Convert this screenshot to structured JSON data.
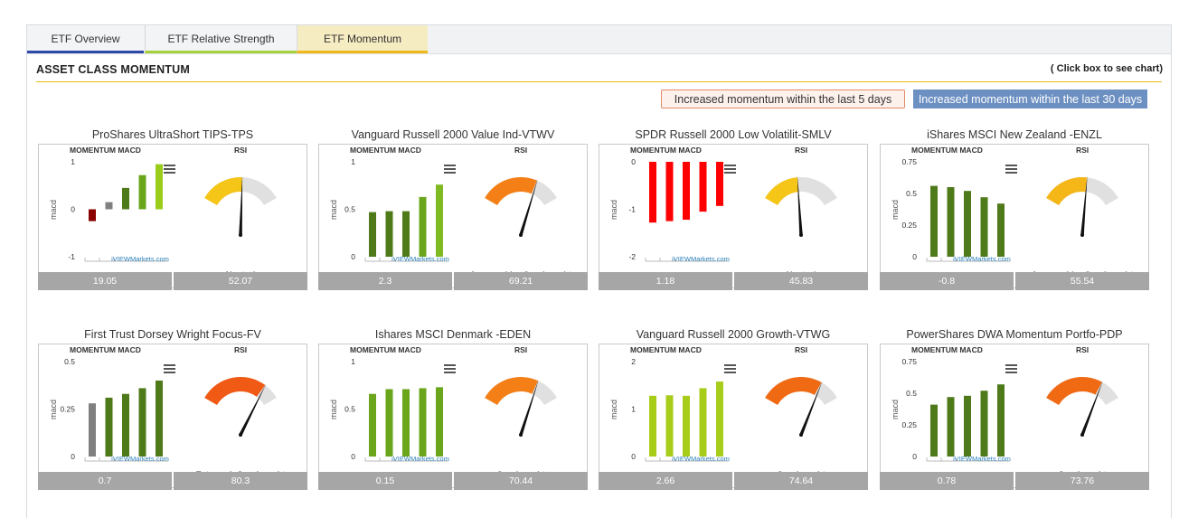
{
  "tabs": [
    {
      "label": "ETF Overview"
    },
    {
      "label": "ETF Relative Strength"
    },
    {
      "label": "ETF Momentum"
    }
  ],
  "header": {
    "title": "ASSET CLASS MOMENTUM",
    "hint": "( Click box to see chart)"
  },
  "legend": {
    "five_day": "Increased momentum within the last 5 days",
    "thirty_day": "Increased momentum within the last 30 days",
    "five_day_color": "#e38a6a",
    "thirty_day_color": "#6d90c2"
  },
  "labels": {
    "macd": "MOMENTUM MACD",
    "rsi": "RSI",
    "axis": "macd",
    "watermark": "iVIEWMarkets.com",
    "menu_icon": "hamburger-menu-icon"
  },
  "chart_data": [
    {
      "type": "bar",
      "title": "ProShares UltraShort TIPS-TPS",
      "ylim": [
        -1,
        1
      ],
      "yticks": [
        1,
        0,
        -1
      ],
      "values": [
        -0.25,
        0.15,
        0.45,
        0.72,
        0.95
      ],
      "colors": [
        "#8b0000",
        "#808080",
        "#4f7a1a",
        "#6aa51c",
        "#9acd1a"
      ],
      "rsi": 52.07,
      "rsi_status": "Neutral",
      "footer_left": "19.05",
      "footer_right": "52.07",
      "gauge_color": "#f5c518"
    },
    {
      "type": "bar",
      "title": "Vanguard Russell 2000 Value Ind-VTWV",
      "ylim": [
        0,
        1
      ],
      "yticks": [
        1,
        0.5,
        0
      ],
      "values": [
        0.47,
        0.48,
        0.48,
        0.63,
        0.76
      ],
      "colors": [
        "#4f7a1a",
        "#4f7a1a",
        "#4f7a1a",
        "#6aa51c",
        "#7fba23"
      ],
      "rsi": 69.21,
      "rsi_status": "ApproachingOverbought",
      "footer_left": "2.3",
      "footer_right": "69.21",
      "gauge_color": "#f57f17"
    },
    {
      "type": "bar",
      "title": "SPDR Russell 2000 Low Volatilit-SMLV",
      "ylim": [
        -2,
        0
      ],
      "yticks": [
        0,
        -1,
        -2
      ],
      "values": [
        -1.28,
        -1.25,
        -1.22,
        -1.05,
        -0.93
      ],
      "colors": [
        "#ff0000",
        "#ff0000",
        "#ff0000",
        "#ff0000",
        "#ff0000"
      ],
      "rsi": 45.83,
      "rsi_status": "Neutral",
      "footer_left": "1.18",
      "footer_right": "45.83",
      "gauge_color": "#f5c518"
    },
    {
      "type": "bar",
      "title": "iShares MSCI New Zealand -ENZL",
      "ylim": [
        0,
        0.75
      ],
      "yticks": [
        0.75,
        0.5,
        0.25,
        0
      ],
      "values": [
        0.56,
        0.55,
        0.52,
        0.47,
        0.42
      ],
      "colors": [
        "#4f7a1a",
        "#4f7a1a",
        "#4f7a1a",
        "#4f7a1a",
        "#4f7a1a"
      ],
      "rsi": 55.54,
      "rsi_status": "ApproachingOverbought",
      "footer_left": "-0.8",
      "footer_right": "55.54",
      "gauge_color": "#f5b618"
    },
    {
      "type": "bar",
      "title": "First Trust Dorsey Wright Focus-FV",
      "ylim": [
        0,
        0.5
      ],
      "yticks": [
        0.5,
        0.25,
        0
      ],
      "values": [
        0.28,
        0.31,
        0.33,
        0.36,
        0.4
      ],
      "colors": [
        "#808080",
        "#4f7a1a",
        "#4f7a1a",
        "#4f7a1a",
        "#4f7a1a"
      ],
      "rsi": 80.3,
      "rsi_status": "ExtremelyOverbought",
      "footer_left": "0.7",
      "footer_right": "80.3",
      "gauge_color": "#f05a14"
    },
    {
      "type": "bar",
      "title": "Ishares MSCI Denmark -EDEN",
      "ylim": [
        0,
        1
      ],
      "yticks": [
        1,
        0.5,
        0
      ],
      "values": [
        0.66,
        0.71,
        0.71,
        0.72,
        0.73
      ],
      "colors": [
        "#6aa51c",
        "#6aa51c",
        "#6aa51c",
        "#6aa51c",
        "#6aa51c"
      ],
      "rsi": 70.44,
      "rsi_status": "Overbought",
      "footer_left": "0.15",
      "footer_right": "70.44",
      "gauge_color": "#f57f17"
    },
    {
      "type": "bar",
      "title": "Vanguard Russell 2000 Growth-VTWG",
      "ylim": [
        0,
        2
      ],
      "yticks": [
        2,
        1,
        0
      ],
      "values": [
        1.28,
        1.29,
        1.28,
        1.44,
        1.58
      ],
      "colors": [
        "#a8cc1a",
        "#a8cc1a",
        "#a8cc1a",
        "#a8cc1a",
        "#a8cc1a"
      ],
      "rsi": 74.64,
      "rsi_status": "Overbought",
      "footer_left": "2.66",
      "footer_right": "74.64",
      "gauge_color": "#f06a14"
    },
    {
      "type": "bar",
      "title": "PowerShares DWA Momentum Portfo-PDP",
      "ylim": [
        0,
        0.75
      ],
      "yticks": [
        0.75,
        0.5,
        0.25,
        0
      ],
      "values": [
        0.41,
        0.47,
        0.48,
        0.52,
        0.57
      ],
      "colors": [
        "#4f7a1a",
        "#4f7a1a",
        "#4f7a1a",
        "#4f7a1a",
        "#4f7a1a"
      ],
      "rsi": 73.76,
      "rsi_status": "Overbought",
      "footer_left": "0.78",
      "footer_right": "73.76",
      "gauge_color": "#f06a14"
    }
  ]
}
